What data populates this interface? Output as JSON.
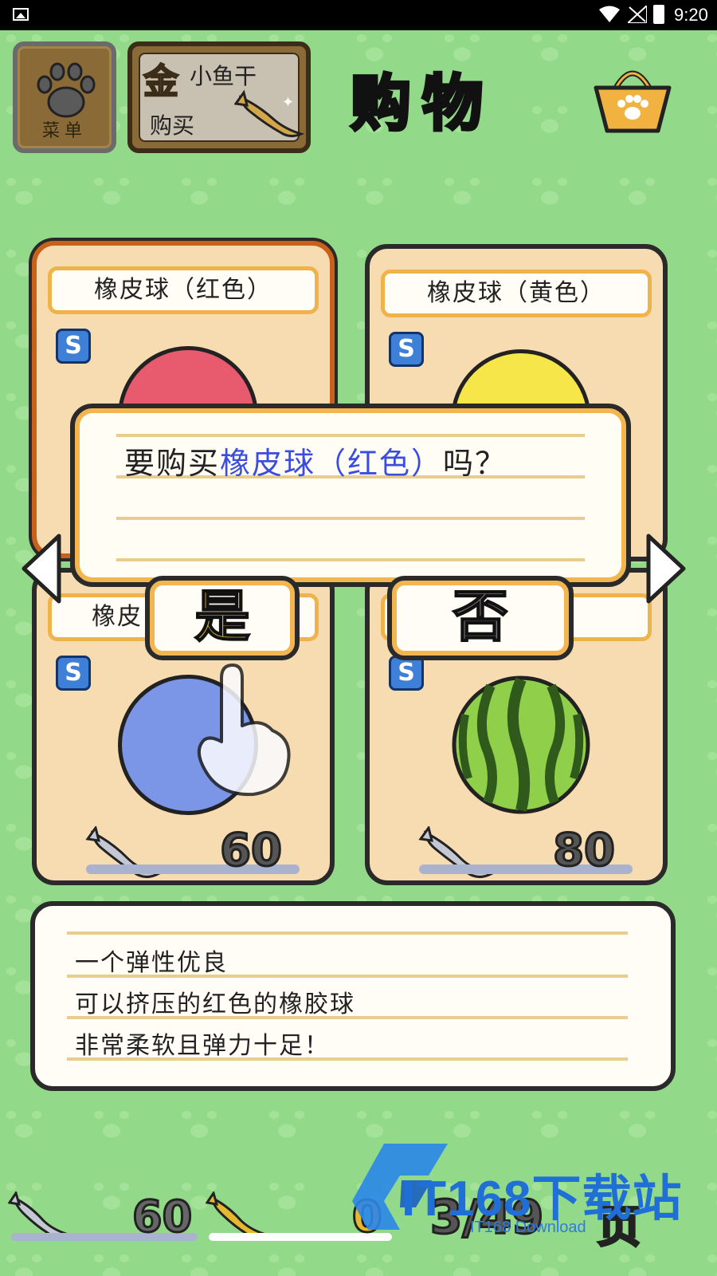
{
  "status_bar": {
    "time": "9:20"
  },
  "header": {
    "menu_label": "菜单",
    "buy_gold_char": "金",
    "buy_line1": "小鱼干",
    "buy_line2": "购买",
    "title": "购物"
  },
  "cards": [
    {
      "name": "橡皮球（红色）",
      "badge": "S",
      "color": "#e85a6e",
      "price": ""
    },
    {
      "name": "橡皮球（黄色）",
      "badge": "S",
      "color": "#f6e649",
      "price": ""
    },
    {
      "name": "橡皮",
      "badge": "S",
      "color": "#7b96e6",
      "price": "60"
    },
    {
      "name": "",
      "badge": "S",
      "color": "#4e8a2c",
      "price": "80"
    }
  ],
  "dialog": {
    "prefix": "要购买",
    "item": "橡皮球（红色）",
    "suffix": "吗？",
    "yes_label": "是",
    "no_label": "否"
  },
  "description": {
    "lines": [
      "一个弹性优良",
      "可以挤压的红色的橡胶球",
      "非常柔软且弹力十足！"
    ]
  },
  "bottom": {
    "fish_count": "60",
    "gold_count": "0",
    "page": "3/49",
    "page_word": "页"
  },
  "watermark": {
    "brand": "IT168下载站",
    "sub": "IT168 Download"
  },
  "colors": {
    "background": "#93d98a",
    "highlight": "#3a4de0",
    "card": "#f6dcb0",
    "selected_border": "#c8621a"
  }
}
